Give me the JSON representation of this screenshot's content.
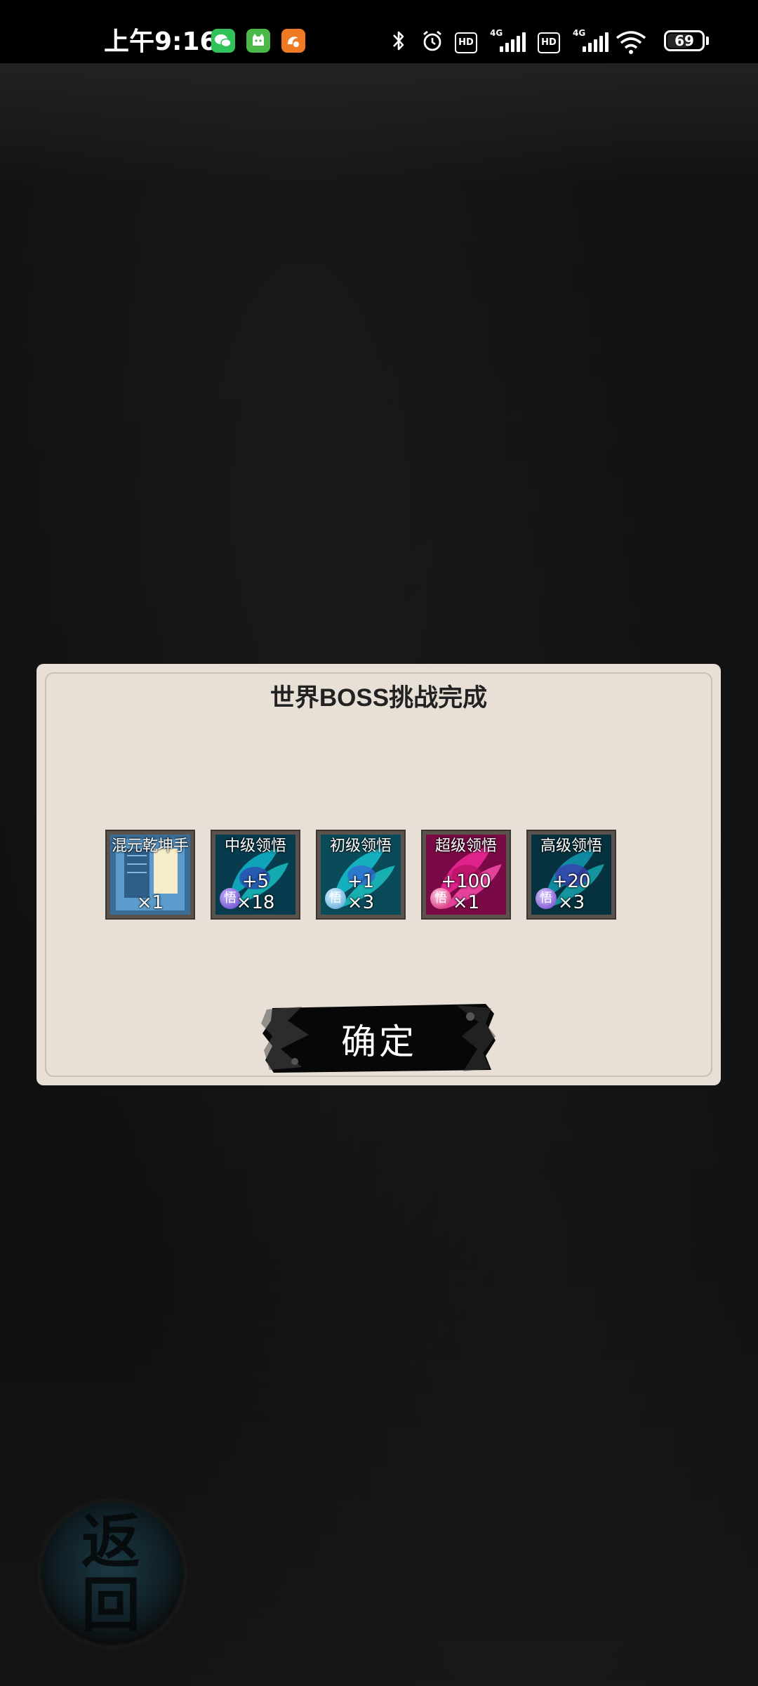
{
  "status_bar": {
    "time": "上午9:16",
    "apps": [
      "wechat-icon",
      "cat-app-icon",
      "uc-browser-icon"
    ],
    "hd_label": "HD",
    "network_label": "4G",
    "battery": "69"
  },
  "dialog": {
    "title": "世界BOSS挑战完成",
    "rewards": [
      {
        "name": "混元乾坤手",
        "value": "",
        "count": "×1",
        "style": "scroll",
        "orb": ""
      },
      {
        "name": "中级领悟",
        "value": "+5",
        "count": "×18",
        "style": "teal",
        "orb": "悟"
      },
      {
        "name": "初级领悟",
        "value": "+1",
        "count": "×3",
        "style": "teal-light",
        "orb": "悟"
      },
      {
        "name": "超级领悟",
        "value": "+100",
        "count": "×1",
        "style": "pink",
        "orb": "悟"
      },
      {
        "name": "高级领悟",
        "value": "+20",
        "count": "×3",
        "style": "teal-dark",
        "orb": "悟"
      }
    ],
    "confirm_label": "确定"
  },
  "back_button": {
    "label": "返回"
  },
  "colors": {
    "dialog_bg": "#e8e0d6",
    "background": "#0f0f0f",
    "pink_item": "#e0238c",
    "teal_item": "#0f8aa0"
  }
}
